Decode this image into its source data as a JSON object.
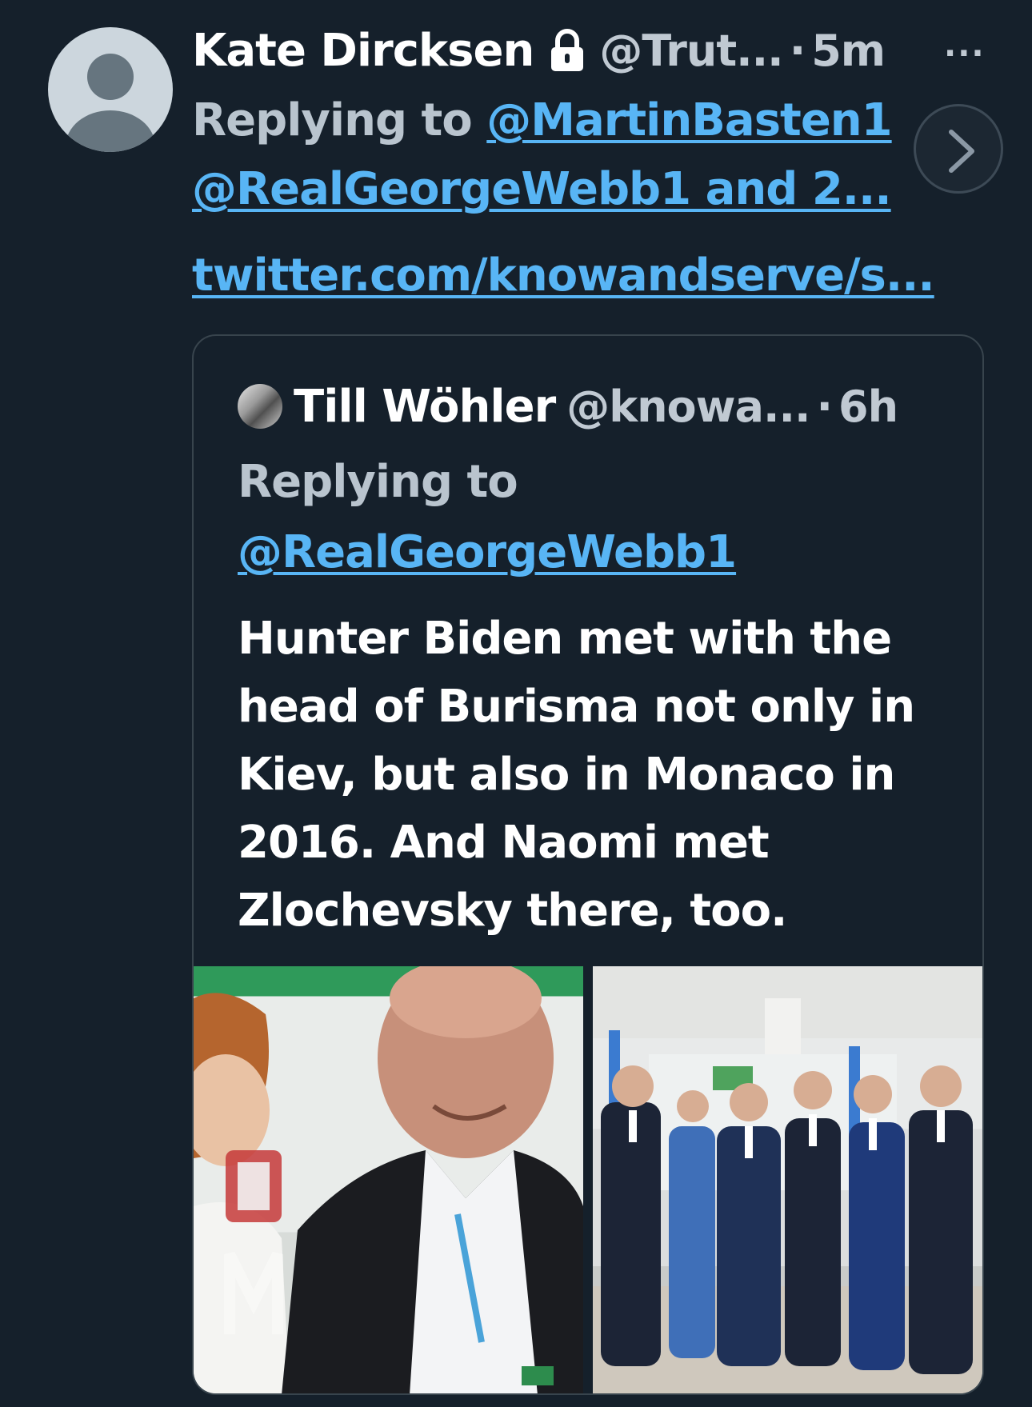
{
  "tweet": {
    "author_name": "Kate Dircksen",
    "author_handle": "@Trut...",
    "separator": "·",
    "time": "5m",
    "more_label": "···",
    "replying_prefix": "Replying to",
    "reply_mention_1": "@MartinBasten1",
    "reply_mention_2": "@RealGeorgeWebb1 and 2...",
    "link_url": "twitter.com/knowandserve/s..."
  },
  "quoted_tweet": {
    "author_name": "Till Wöhler",
    "author_handle": "@knowa...",
    "separator": "·",
    "time": "6h",
    "replying_prefix": "Replying to",
    "reply_mention": "@RealGeorgeWebb1",
    "text": "Hunter Biden met with the\nhead of Burisma not only in\nKiev, but also in Monaco in\n2016. And Naomi met\nZlochevsky there, too.",
    "media": [
      {
        "kind": "photo",
        "subject": "woman and bald man in white shirt"
      },
      {
        "kind": "photo",
        "subject": "group of men in suits at event"
      }
    ]
  },
  "colors": {
    "background": "#15202b",
    "link": "#58b5f5",
    "muted": "#b9c4ce",
    "border": "#38444d"
  },
  "icons": [
    "lock-icon",
    "chevron-right-icon",
    "more-icon"
  ]
}
